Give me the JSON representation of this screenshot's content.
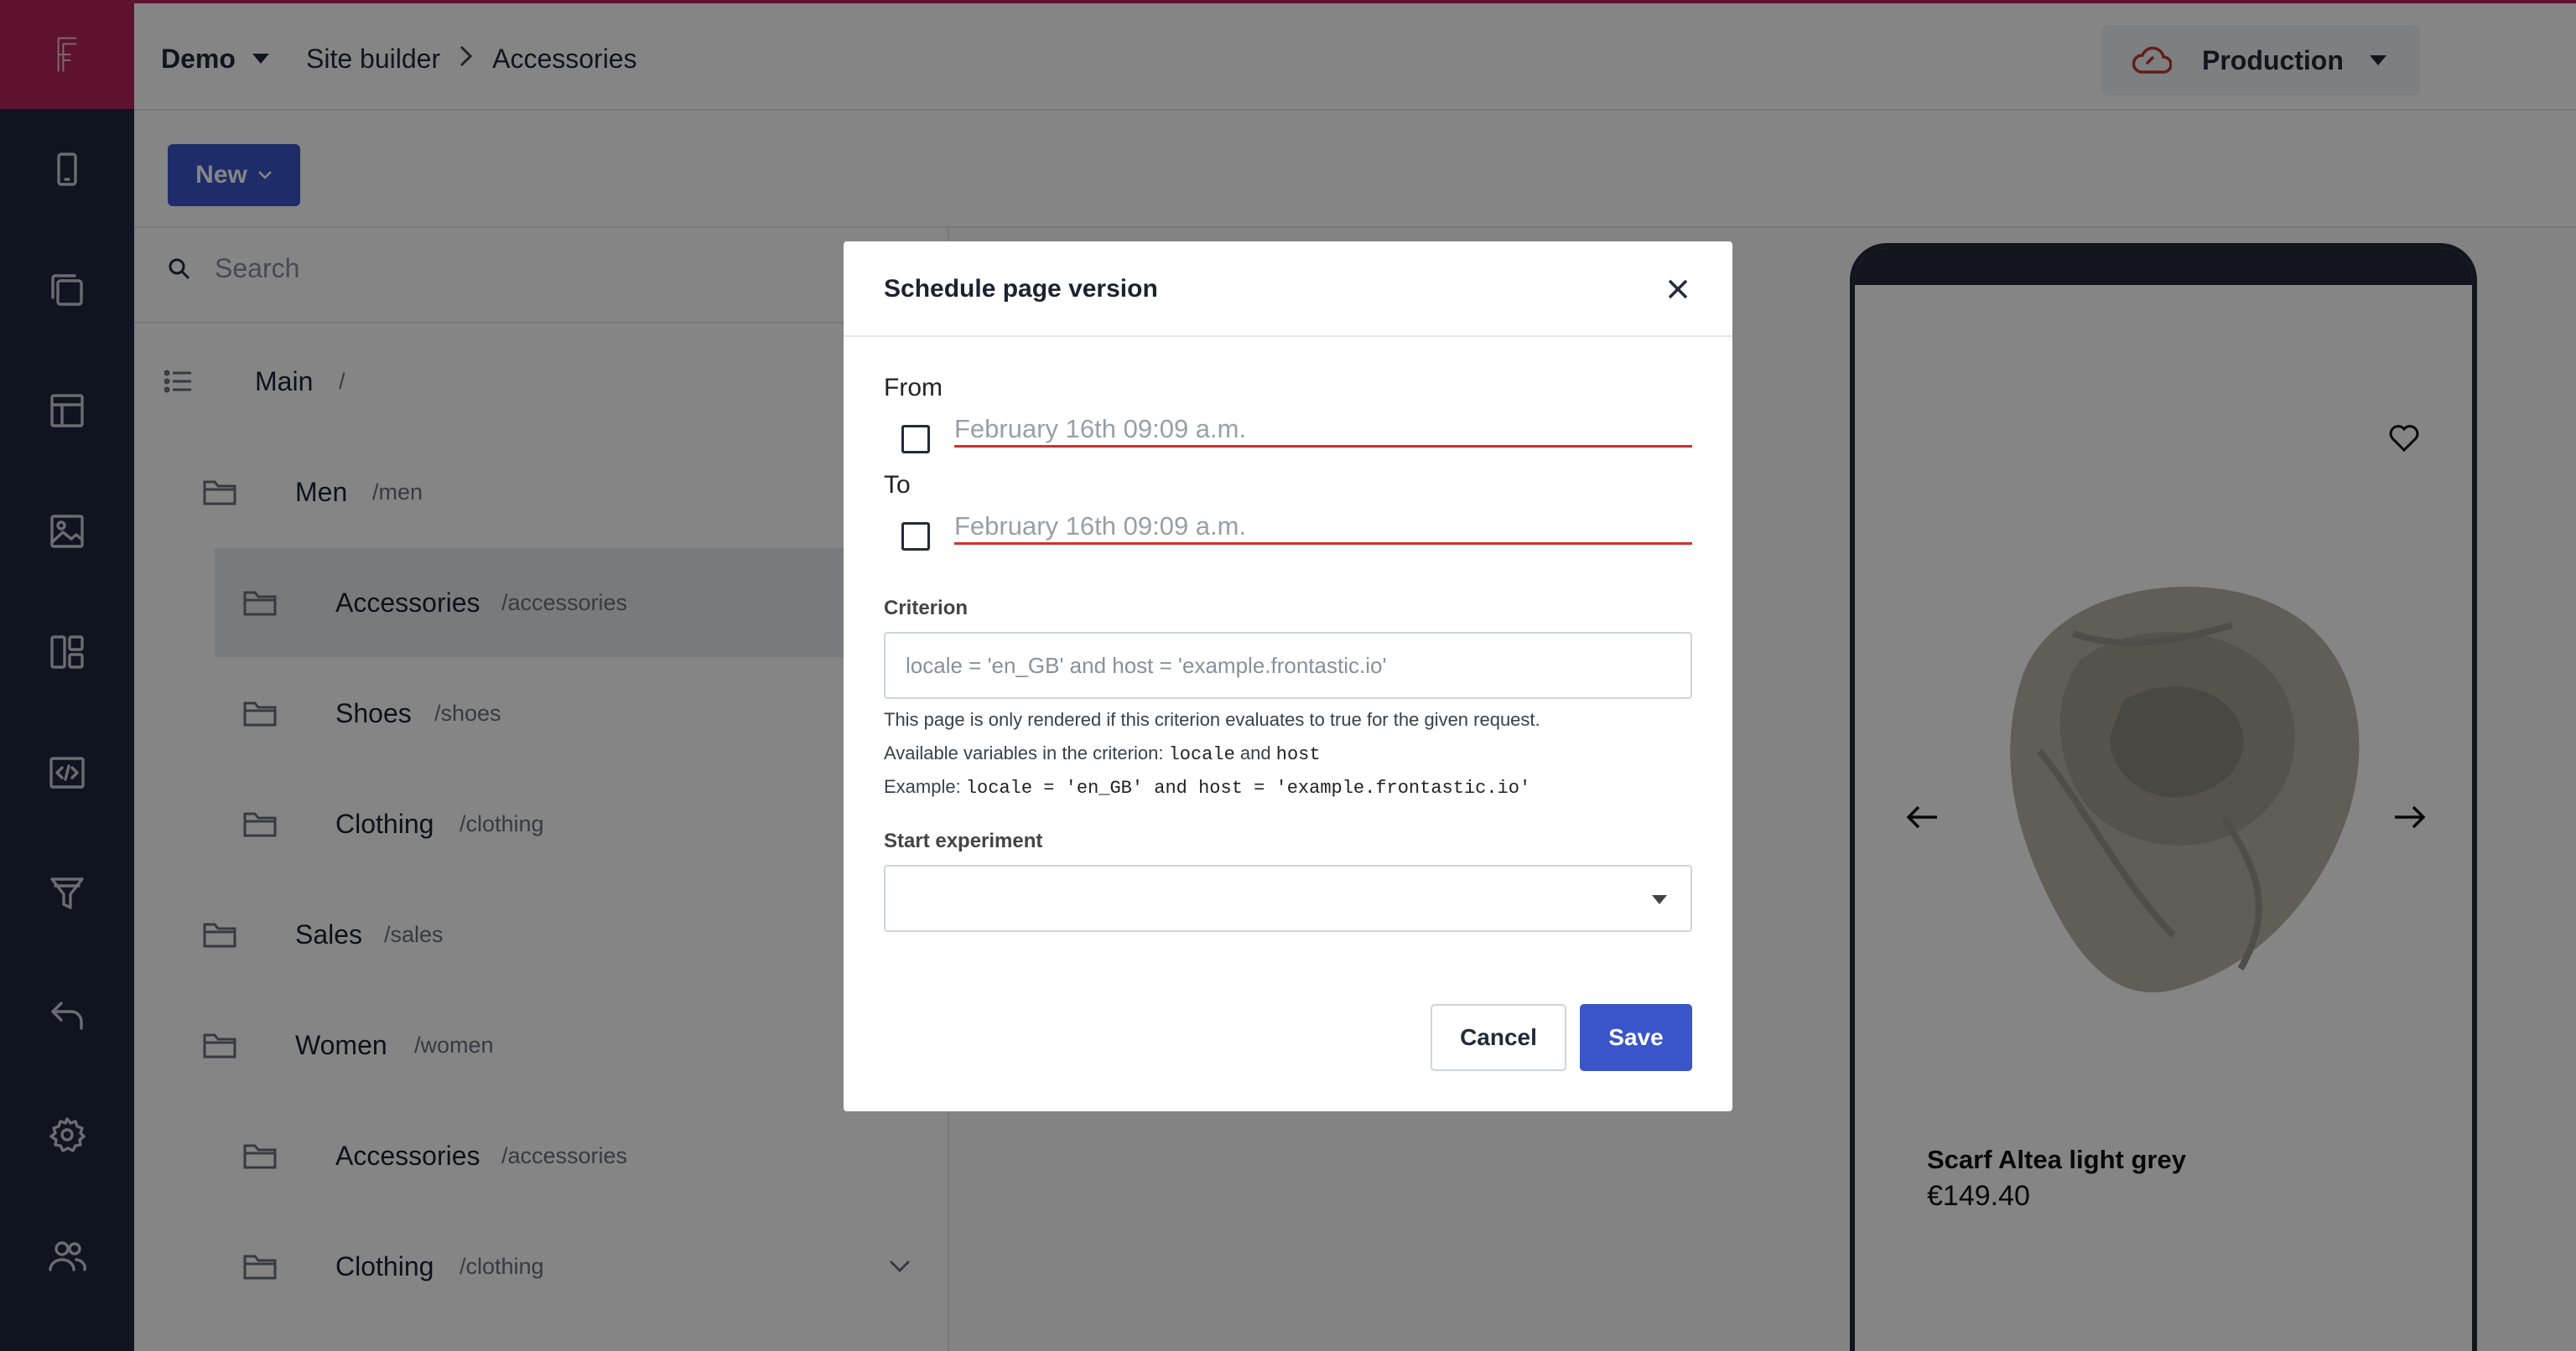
{
  "header": {
    "project": "Demo",
    "breadcrumb": [
      "Site builder",
      "Accessories"
    ],
    "environment": "Production"
  },
  "toolbar": {
    "new_label": "New"
  },
  "tree": {
    "search_placeholder": "Search",
    "root": {
      "name": "Main",
      "path": "/"
    },
    "items": [
      {
        "name": "Men",
        "path": "/men"
      },
      {
        "name": "Accessories",
        "path": "/accessories"
      },
      {
        "name": "Shoes",
        "path": "/shoes"
      },
      {
        "name": "Clothing",
        "path": "/clothing"
      },
      {
        "name": "Sales",
        "path": "/sales"
      },
      {
        "name": "Women",
        "path": "/women"
      },
      {
        "name": "Accessories",
        "path": "/accessories"
      },
      {
        "name": "Clothing",
        "path": "/clothing"
      }
    ]
  },
  "preview": {
    "product_name": "Scarf Altea light grey",
    "product_price": "€149.40"
  },
  "modal": {
    "title": "Schedule page version",
    "from_label": "From",
    "from_value": "February 16th 09:09 a.m.",
    "to_label": "To",
    "to_value": "February 16th 09:09 a.m.",
    "criterion_label": "Criterion",
    "criterion_placeholder": "locale = 'en_GB' and host = 'example.frontastic.io'",
    "help_line1": "This page is only rendered if this criterion evaluates to true for the given request.",
    "help_line2_pre": "Available variables in the criterion:",
    "help_var1": "locale",
    "help_and": "and",
    "help_var2": "host",
    "help_line3_pre": "Example:",
    "help_example": "locale = 'en_GB' and host = 'example.frontastic.io'",
    "experiment_label": "Start experiment",
    "cancel_label": "Cancel",
    "save_label": "Save"
  },
  "colors": {
    "sidebar": "#1f2740",
    "brand": "#b4235a",
    "primary_button": "#3a55c9",
    "error_underline": "#d32f2f"
  }
}
